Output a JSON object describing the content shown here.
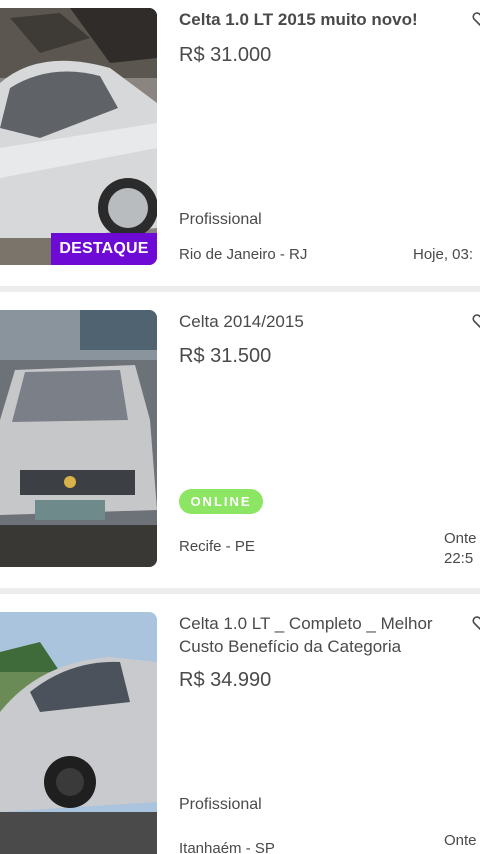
{
  "listings": [
    {
      "title": "Celta 1.0 LT 2015 muito novo!",
      "price": "R$ 31.000",
      "seller_type": "Profissional",
      "location": "Rio de Janeiro - RJ",
      "date": "Hoje, 03:",
      "badge": "DESTAQUE",
      "photo": "silver-car-photo"
    },
    {
      "title": "Celta 2014/2015",
      "price": "R$ 31.500",
      "status": "ONLINE",
      "location": "Recife - PE",
      "date_line1": "Onte",
      "date_line2": "22:5",
      "photo": "silver-car-front-photo"
    },
    {
      "title": "Celta 1.0 LT _ Completo _ Melhor Custo Benefício da Categoria",
      "price": "R$ 34.990",
      "seller_type": "Profissional",
      "location": "Itanhaém - SP",
      "date_line1": "Onte",
      "photo": "silver-car-side-photo"
    }
  ],
  "colors": {
    "highlight_badge": "#6e0ad6",
    "online_badge": "#8ce563",
    "background": "#ececec",
    "card": "#ffffff",
    "text": "#4a4a4a"
  },
  "icons": {
    "favorite": "heart-outline-icon"
  }
}
